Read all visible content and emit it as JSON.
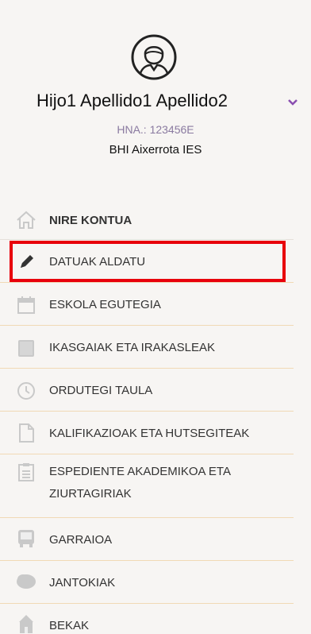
{
  "profile": {
    "name": "Hijo1 Apellido1 Apellido2",
    "hna": "HNA.: 123456E",
    "school": "BHI Aixerrota IES",
    "icons": {
      "avatar": "user-avatar-icon",
      "toggle": "chevron-down-icon"
    },
    "colors": {
      "chevron": "#8a4fb0"
    }
  },
  "menu": {
    "header": {
      "label": "NIRE KONTUA",
      "icon": "home-icon"
    },
    "items": [
      {
        "label": "DATUAK ALDATU",
        "icon": "pencil-icon",
        "selected": true
      },
      {
        "label": "ESKOLA EGUTEGIA",
        "icon": "calendar-icon"
      },
      {
        "label": "IKASGAIAK ETA IRAKASLEAK",
        "icon": "book-icon"
      },
      {
        "label": "ORDUTEGI TAULA",
        "icon": "clock-icon"
      },
      {
        "label": "KALIFIKAZIOAK ETA HUTSEGITEAK",
        "icon": "document-icon"
      },
      {
        "label_line1": "ESPEDIENTE AKADEMIKOA ETA",
        "label_line2": "ZIURTAGIRIAK",
        "icon": "clipboard-icon"
      },
      {
        "label": "GARRAIOA",
        "icon": "bus-icon"
      },
      {
        "label": "JANTOKIAK",
        "icon": "cloud-icon"
      },
      {
        "label": "BEKAK",
        "icon": "building-icon"
      }
    ],
    "colors": {
      "highlight": "#e8000b",
      "divider": "#f1d9b5",
      "icon": "#c9c9c9"
    }
  }
}
